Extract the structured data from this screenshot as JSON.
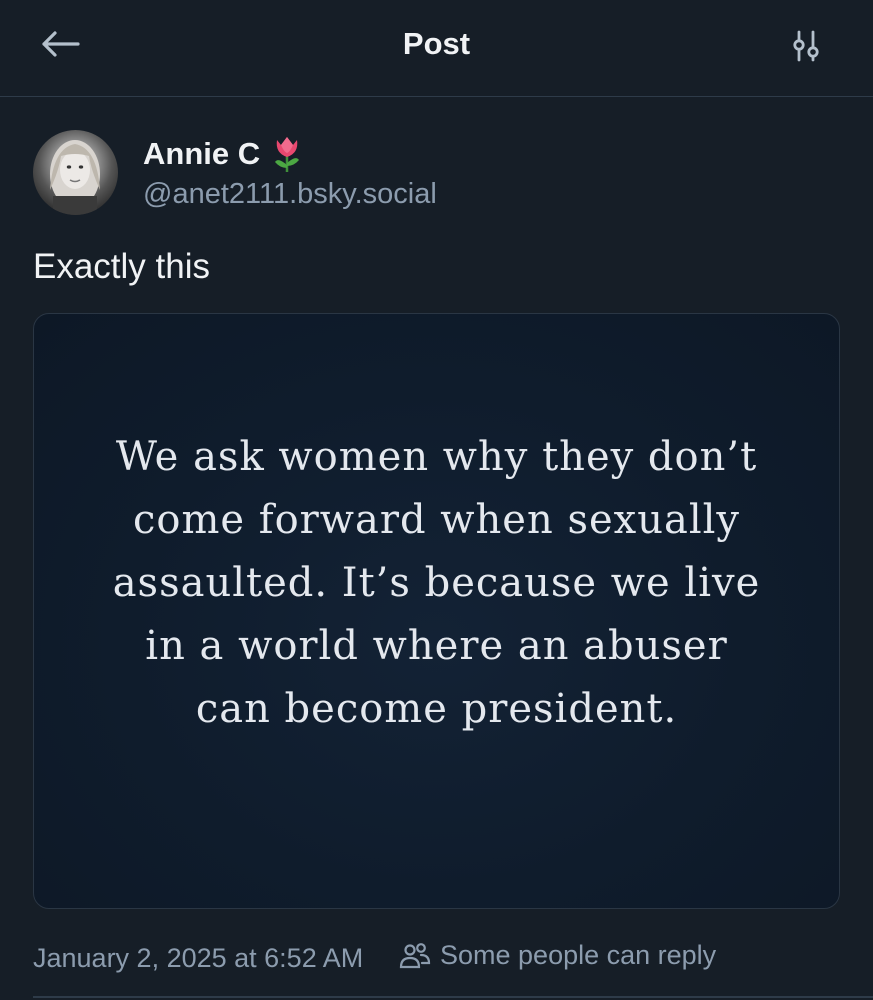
{
  "header": {
    "title": "Post",
    "back_icon": "arrow-left-icon",
    "settings_icon": "sliders-icon"
  },
  "author": {
    "display_name": "Annie C",
    "emoji": "🌷",
    "handle": "@anet2111.bsky.social"
  },
  "post": {
    "text": "Exactly this",
    "image_text": [
      "We ask women why they don’t",
      "come forward when sexually",
      "assaulted. It’s because we live",
      "in a world where an abuser",
      "can become president."
    ]
  },
  "meta": {
    "timestamp": "January 2, 2025 at 6:52 AM",
    "reply_setting": "Some people can reply",
    "reply_icon": "people-icon"
  },
  "colors": {
    "background": "#161e27",
    "text_primary": "#f1f3f5",
    "text_secondary": "#8c9cae",
    "divider": "#2e3b49"
  }
}
